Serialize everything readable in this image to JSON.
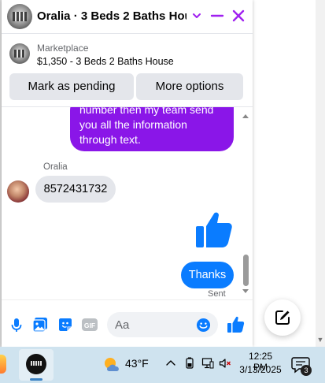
{
  "header": {
    "title": "Oralia · 3 Beds 2 Baths Hou..."
  },
  "marketplace": {
    "label": "Marketplace",
    "listing": "$1,350 - 3 Beds 2 Baths House",
    "pending_button": "Mark as pending",
    "more_button": "More options"
  },
  "messages": {
    "outgoing_lines": [
      "number then my team send",
      "you all the information",
      "through text."
    ],
    "sender_name": "Oralia",
    "incoming_text": "8572431732",
    "thanks_text": "Thanks",
    "status": "Sent"
  },
  "composer": {
    "placeholder": "Aa",
    "gif_label": "GIF"
  },
  "taskbar": {
    "temperature": "43°F",
    "time": "12:25 PM",
    "date": "3/13/2025",
    "notification_count": "3"
  },
  "colors": {
    "messenger_accent": "#a020f0",
    "outgoing_bubble": "#8a16e8",
    "thanks_bubble": "#0a7cff",
    "icon_blue": "#0a7cff"
  },
  "icons": {
    "header": [
      "chevron-down-icon",
      "minimize-icon",
      "close-icon"
    ],
    "composer": [
      "microphone-icon",
      "photo-icon",
      "sticker-icon",
      "gif-icon",
      "emoji-icon",
      "thumbs-up-icon"
    ],
    "other": [
      "compose-icon",
      "weather-icon",
      "notification-icon"
    ]
  }
}
